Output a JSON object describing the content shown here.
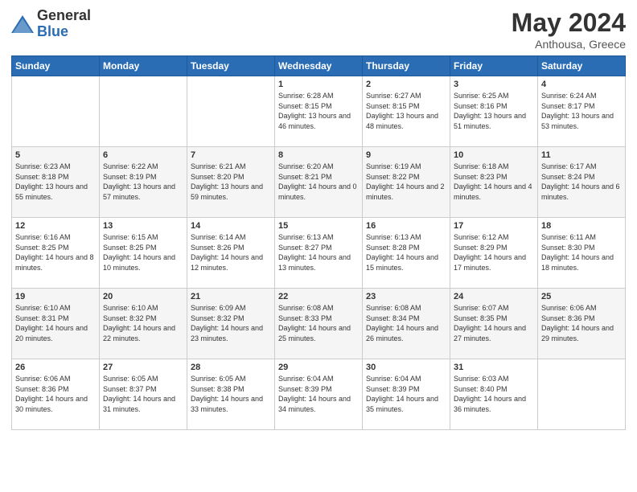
{
  "header": {
    "logo_general": "General",
    "logo_blue": "Blue",
    "title": "May 2024",
    "location": "Anthousa, Greece"
  },
  "days_of_week": [
    "Sunday",
    "Monday",
    "Tuesday",
    "Wednesday",
    "Thursday",
    "Friday",
    "Saturday"
  ],
  "weeks": [
    [
      {
        "day": "",
        "info": ""
      },
      {
        "day": "",
        "info": ""
      },
      {
        "day": "",
        "info": ""
      },
      {
        "day": "1",
        "info": "Sunrise: 6:28 AM\nSunset: 8:15 PM\nDaylight: 13 hours\nand 46 minutes."
      },
      {
        "day": "2",
        "info": "Sunrise: 6:27 AM\nSunset: 8:15 PM\nDaylight: 13 hours\nand 48 minutes."
      },
      {
        "day": "3",
        "info": "Sunrise: 6:25 AM\nSunset: 8:16 PM\nDaylight: 13 hours\nand 51 minutes."
      },
      {
        "day": "4",
        "info": "Sunrise: 6:24 AM\nSunset: 8:17 PM\nDaylight: 13 hours\nand 53 minutes."
      }
    ],
    [
      {
        "day": "5",
        "info": "Sunrise: 6:23 AM\nSunset: 8:18 PM\nDaylight: 13 hours\nand 55 minutes."
      },
      {
        "day": "6",
        "info": "Sunrise: 6:22 AM\nSunset: 8:19 PM\nDaylight: 13 hours\nand 57 minutes."
      },
      {
        "day": "7",
        "info": "Sunrise: 6:21 AM\nSunset: 8:20 PM\nDaylight: 13 hours\nand 59 minutes."
      },
      {
        "day": "8",
        "info": "Sunrise: 6:20 AM\nSunset: 8:21 PM\nDaylight: 14 hours\nand 0 minutes."
      },
      {
        "day": "9",
        "info": "Sunrise: 6:19 AM\nSunset: 8:22 PM\nDaylight: 14 hours\nand 2 minutes."
      },
      {
        "day": "10",
        "info": "Sunrise: 6:18 AM\nSunset: 8:23 PM\nDaylight: 14 hours\nand 4 minutes."
      },
      {
        "day": "11",
        "info": "Sunrise: 6:17 AM\nSunset: 8:24 PM\nDaylight: 14 hours\nand 6 minutes."
      }
    ],
    [
      {
        "day": "12",
        "info": "Sunrise: 6:16 AM\nSunset: 8:25 PM\nDaylight: 14 hours\nand 8 minutes."
      },
      {
        "day": "13",
        "info": "Sunrise: 6:15 AM\nSunset: 8:25 PM\nDaylight: 14 hours\nand 10 minutes."
      },
      {
        "day": "14",
        "info": "Sunrise: 6:14 AM\nSunset: 8:26 PM\nDaylight: 14 hours\nand 12 minutes."
      },
      {
        "day": "15",
        "info": "Sunrise: 6:13 AM\nSunset: 8:27 PM\nDaylight: 14 hours\nand 13 minutes."
      },
      {
        "day": "16",
        "info": "Sunrise: 6:13 AM\nSunset: 8:28 PM\nDaylight: 14 hours\nand 15 minutes."
      },
      {
        "day": "17",
        "info": "Sunrise: 6:12 AM\nSunset: 8:29 PM\nDaylight: 14 hours\nand 17 minutes."
      },
      {
        "day": "18",
        "info": "Sunrise: 6:11 AM\nSunset: 8:30 PM\nDaylight: 14 hours\nand 18 minutes."
      }
    ],
    [
      {
        "day": "19",
        "info": "Sunrise: 6:10 AM\nSunset: 8:31 PM\nDaylight: 14 hours\nand 20 minutes."
      },
      {
        "day": "20",
        "info": "Sunrise: 6:10 AM\nSunset: 8:32 PM\nDaylight: 14 hours\nand 22 minutes."
      },
      {
        "day": "21",
        "info": "Sunrise: 6:09 AM\nSunset: 8:32 PM\nDaylight: 14 hours\nand 23 minutes."
      },
      {
        "day": "22",
        "info": "Sunrise: 6:08 AM\nSunset: 8:33 PM\nDaylight: 14 hours\nand 25 minutes."
      },
      {
        "day": "23",
        "info": "Sunrise: 6:08 AM\nSunset: 8:34 PM\nDaylight: 14 hours\nand 26 minutes."
      },
      {
        "day": "24",
        "info": "Sunrise: 6:07 AM\nSunset: 8:35 PM\nDaylight: 14 hours\nand 27 minutes."
      },
      {
        "day": "25",
        "info": "Sunrise: 6:06 AM\nSunset: 8:36 PM\nDaylight: 14 hours\nand 29 minutes."
      }
    ],
    [
      {
        "day": "26",
        "info": "Sunrise: 6:06 AM\nSunset: 8:36 PM\nDaylight: 14 hours\nand 30 minutes."
      },
      {
        "day": "27",
        "info": "Sunrise: 6:05 AM\nSunset: 8:37 PM\nDaylight: 14 hours\nand 31 minutes."
      },
      {
        "day": "28",
        "info": "Sunrise: 6:05 AM\nSunset: 8:38 PM\nDaylight: 14 hours\nand 33 minutes."
      },
      {
        "day": "29",
        "info": "Sunrise: 6:04 AM\nSunset: 8:39 PM\nDaylight: 14 hours\nand 34 minutes."
      },
      {
        "day": "30",
        "info": "Sunrise: 6:04 AM\nSunset: 8:39 PM\nDaylight: 14 hours\nand 35 minutes."
      },
      {
        "day": "31",
        "info": "Sunrise: 6:03 AM\nSunset: 8:40 PM\nDaylight: 14 hours\nand 36 minutes."
      },
      {
        "day": "",
        "info": ""
      }
    ]
  ]
}
